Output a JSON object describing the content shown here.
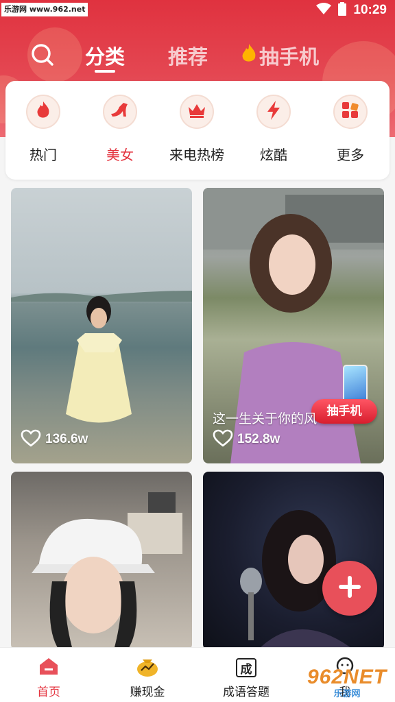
{
  "status_bar": {
    "watermark": "乐游网 www.962.net",
    "time": "10:29"
  },
  "nav": {
    "tabs": [
      {
        "label": "分类",
        "active": true
      },
      {
        "label": "推荐",
        "active": false
      },
      {
        "label": "抽手机",
        "active": false
      }
    ]
  },
  "categories": [
    {
      "label": "热门",
      "icon": "flame-icon",
      "active": false
    },
    {
      "label": "美女",
      "icon": "high-heel-icon",
      "active": true
    },
    {
      "label": "来电热榜",
      "icon": "crown-icon",
      "active": false
    },
    {
      "label": "炫酷",
      "icon": "lightning-icon",
      "active": false
    },
    {
      "label": "更多",
      "icon": "grid-icon",
      "active": false
    }
  ],
  "videos": [
    {
      "likes": "136.6w",
      "caption": ""
    },
    {
      "likes": "152.8w",
      "caption": "这一生关于你的风",
      "promo": "抽手机"
    },
    {
      "likes": "",
      "caption": ""
    },
    {
      "likes": "",
      "caption": ""
    }
  ],
  "bottom_nav": [
    {
      "label": "首页",
      "icon": "home-icon",
      "active": true
    },
    {
      "label": "赚现金",
      "icon": "money-bag-icon",
      "active": false
    },
    {
      "label": "成语答题",
      "icon": "idiom-quiz-icon",
      "active": false
    },
    {
      "label": "我",
      "icon": "profile-icon",
      "active": false
    }
  ],
  "idiom_icon_char": "成",
  "brand_watermark": {
    "big": "962NET",
    "small": "乐游网"
  },
  "colors": {
    "accent": "#e4343f",
    "header": "#e0323f",
    "fab": "#e8505a"
  }
}
